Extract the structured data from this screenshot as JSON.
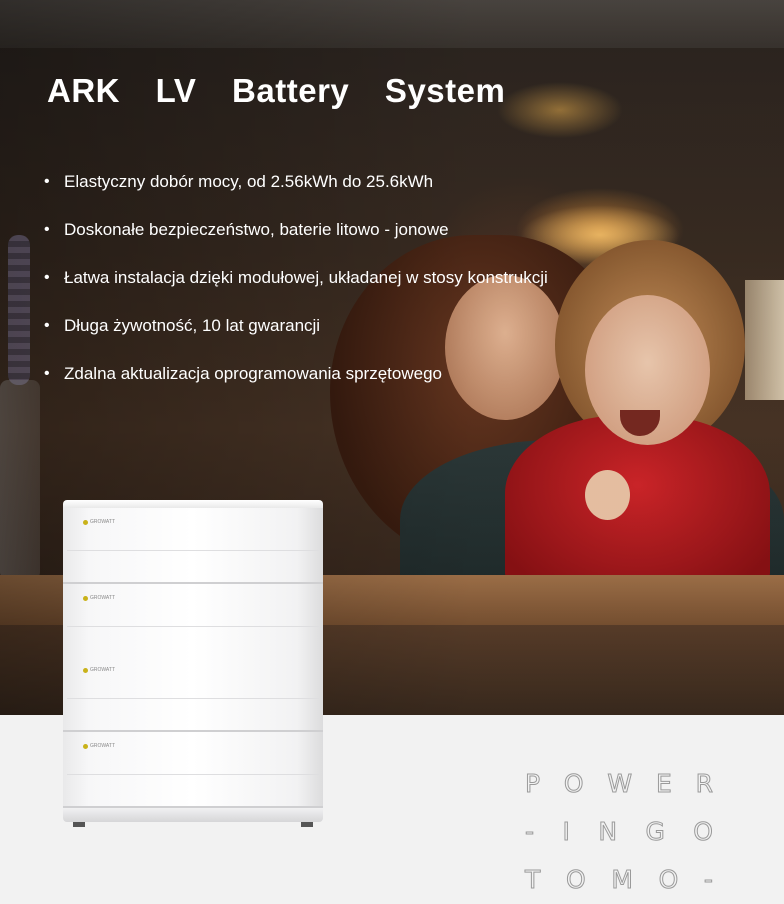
{
  "hero": {
    "title": "ARK LV Battery System",
    "features": [
      "Elastyczny dobór mocy, od 2.56kWh do 25.6kWh",
      "Doskonałe bezpieczeństwo, baterie litowo - jonowe",
      "Łatwa instalacja dzięki modułowej, układanej w stosy konstrukcji",
      "Długa żywotność, 10 lat gwarancji",
      "Zdalna aktualizacja oprogramowania sprzętowego"
    ],
    "bullet": "•"
  },
  "battery": {
    "module_brand": "GROWATT",
    "module_count": 4
  },
  "brand_mark": {
    "lines": [
      [
        "P",
        "O",
        "W",
        "E",
        "R"
      ],
      [
        "-",
        "I",
        "N",
        "G",
        "O"
      ],
      [
        "T",
        "O",
        "M",
        "O",
        "-"
      ]
    ]
  },
  "colors": {
    "title_text": "#ffffff",
    "logo_accent": "#c9b21a",
    "lower_background": "#f2f2f2"
  }
}
